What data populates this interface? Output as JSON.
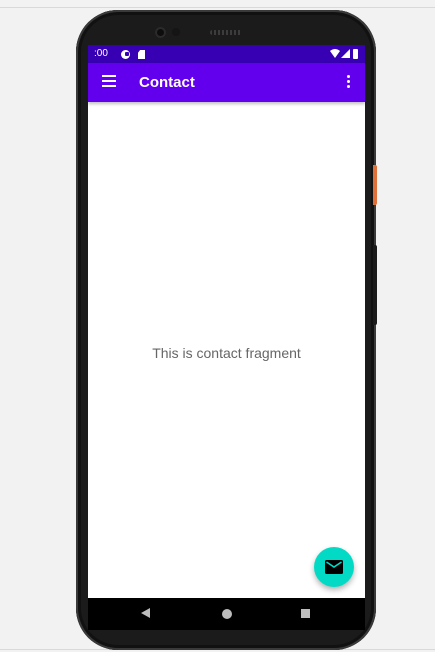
{
  "status_bar": {
    "time": ":00"
  },
  "app_bar": {
    "title": "Contact",
    "background_color": "#6200ee",
    "status_bar_color": "#3700b3"
  },
  "main": {
    "message": "This is contact fragment"
  },
  "fab": {
    "icon": "mail-icon",
    "color": "#03dac5"
  },
  "nav_bar": {
    "buttons": [
      "back-icon",
      "home-icon",
      "recents-icon"
    ]
  }
}
